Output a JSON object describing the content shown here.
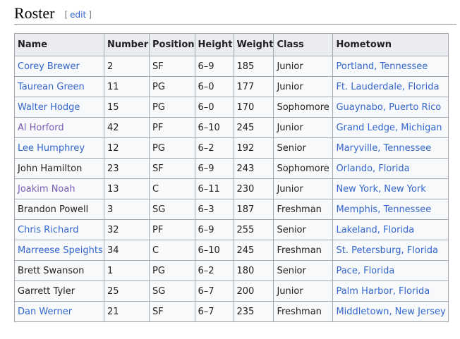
{
  "section": {
    "title": "Roster",
    "edit_open": "[",
    "edit_label": "edit",
    "edit_close": "]"
  },
  "colors": {
    "link": "#3366cc",
    "visited_link": "#795cb2",
    "header_bg": "#eaecf0",
    "border": "#a2a9b1"
  },
  "table": {
    "headers": [
      "Name",
      "Number",
      "Position",
      "Height",
      "Weight",
      "Class",
      "Hometown"
    ],
    "rows": [
      {
        "name": "Corey Brewer",
        "name_style": "link",
        "number": "2",
        "position": "SF",
        "height": "6–9",
        "weight": "185",
        "class": "Junior",
        "hometown": "Portland, Tennessee",
        "hometown_style": "link"
      },
      {
        "name": "Taurean Green",
        "name_style": "link",
        "number": "11",
        "position": "PG",
        "height": "6–0",
        "weight": "177",
        "class": "Junior",
        "hometown": "Ft. Lauderdale, Florida",
        "hometown_style": "link"
      },
      {
        "name": "Walter Hodge",
        "name_style": "link",
        "number": "15",
        "position": "PG",
        "height": "6–0",
        "weight": "170",
        "class": "Sophomore",
        "hometown": "Guaynabo, Puerto Rico",
        "hometown_style": "link"
      },
      {
        "name": "Al Horford",
        "name_style": "visited",
        "number": "42",
        "position": "PF",
        "height": "6–10",
        "weight": "245",
        "class": "Junior",
        "hometown": "Grand Ledge, Michigan",
        "hometown_style": "link"
      },
      {
        "name": "Lee Humphrey",
        "name_style": "link",
        "number": "12",
        "position": "PG",
        "height": "6–2",
        "weight": "192",
        "class": "Senior",
        "hometown": "Maryville, Tennessee",
        "hometown_style": "link"
      },
      {
        "name": "John Hamilton",
        "name_style": "plain",
        "number": "23",
        "position": "SF",
        "height": "6–9",
        "weight": "243",
        "class": "Sophomore",
        "hometown": "Orlando, Florida",
        "hometown_style": "link"
      },
      {
        "name": "Joakim Noah",
        "name_style": "visited",
        "number": "13",
        "position": "C",
        "height": "6–11",
        "weight": "230",
        "class": "Junior",
        "hometown": "New York, New York",
        "hometown_style": "link"
      },
      {
        "name": "Brandon Powell",
        "name_style": "plain",
        "number": "3",
        "position": "SG",
        "height": "6–3",
        "weight": "187",
        "class": "Freshman",
        "hometown": "Memphis, Tennessee",
        "hometown_style": "link"
      },
      {
        "name": "Chris Richard",
        "name_style": "link",
        "number": "32",
        "position": "PF",
        "height": "6–9",
        "weight": "255",
        "class": "Senior",
        "hometown": "Lakeland, Florida",
        "hometown_style": "link"
      },
      {
        "name": "Marreese Speights",
        "name_style": "link",
        "number": "34",
        "position": "C",
        "height": "6–10",
        "weight": "245",
        "class": "Freshman",
        "hometown": "St. Petersburg, Florida",
        "hometown_style": "link"
      },
      {
        "name": "Brett Swanson",
        "name_style": "plain",
        "number": "1",
        "position": "PG",
        "height": "6–2",
        "weight": "180",
        "class": "Senior",
        "hometown": "Pace, Florida",
        "hometown_style": "link"
      },
      {
        "name": "Garrett Tyler",
        "name_style": "plain",
        "number": "25",
        "position": "SG",
        "height": "6–7",
        "weight": "200",
        "class": "Junior",
        "hometown": "Palm Harbor, Florida",
        "hometown_style": "link"
      },
      {
        "name": "Dan Werner",
        "name_style": "link",
        "number": "21",
        "position": "SF",
        "height": "6–7",
        "weight": "235",
        "class": "Freshman",
        "hometown": "Middletown, New Jersey",
        "hometown_style": "link"
      }
    ]
  }
}
